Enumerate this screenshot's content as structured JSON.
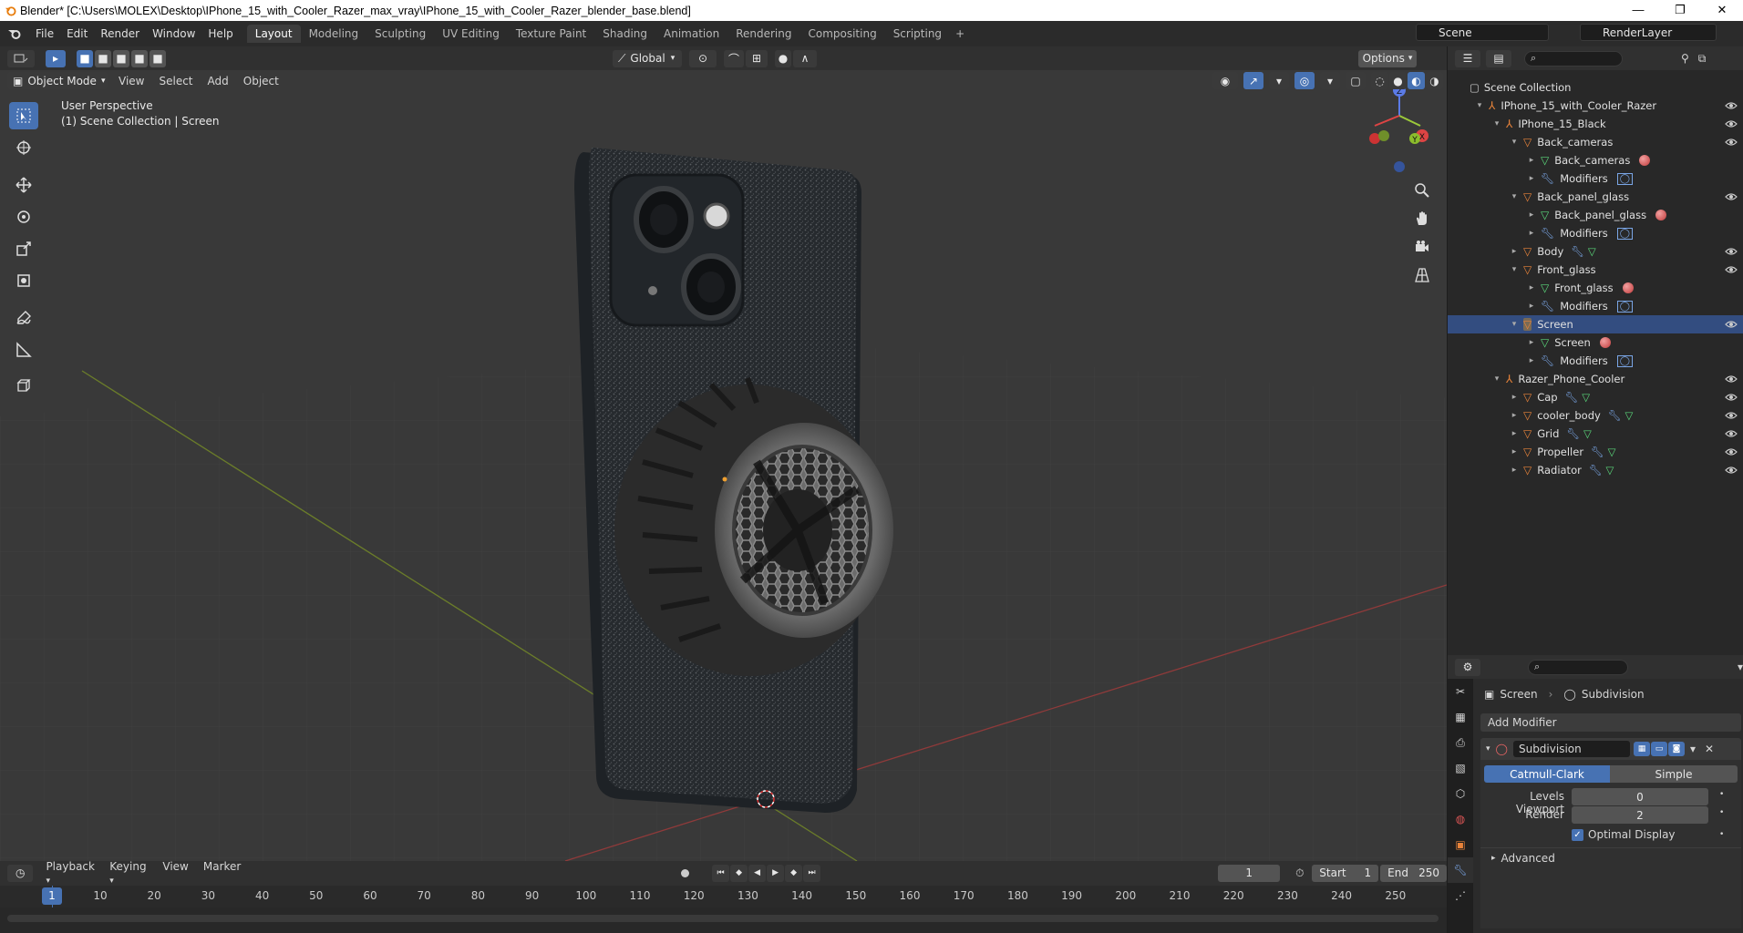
{
  "window": {
    "title": "Blender* [C:\\Users\\MOLEX\\Desktop\\IPhone_15_with_Cooler_Razer_max_vray\\IPhone_15_with_Cooler_Razer_blender_base.blend]",
    "minimize": "—",
    "maximize": "❐",
    "close": "✕"
  },
  "menu": [
    "File",
    "Edit",
    "Render",
    "Window",
    "Help"
  ],
  "workspaces": [
    "Layout",
    "Modeling",
    "Sculpting",
    "UV Editing",
    "Texture Paint",
    "Shading",
    "Animation",
    "Rendering",
    "Compositing",
    "Scripting"
  ],
  "workspace_active": "Layout",
  "workspace_add": "+",
  "scene": {
    "label": "Scene",
    "layer": "RenderLayer"
  },
  "header3d": {
    "transform_orient": "Global",
    "options": "Options"
  },
  "header3d_menu": {
    "mode": "Object Mode",
    "items": [
      "View",
      "Select",
      "Add",
      "Object"
    ]
  },
  "viewport_info": {
    "line1": "User Perspective",
    "line2": "(1) Scene Collection | Screen"
  },
  "gizmo": {
    "x": "X",
    "y": "Y",
    "z": "Z"
  },
  "outliner": {
    "root": "Scene Collection",
    "rows": [
      {
        "label": "IPhone_15_with_Cooler_Razer",
        "indent": 1,
        "type": "empty",
        "arrow": "▾",
        "eye": true
      },
      {
        "label": "IPhone_15_Black",
        "indent": 2,
        "type": "empty",
        "arrow": "▾",
        "eye": true
      },
      {
        "label": "Back_cameras",
        "indent": 3,
        "type": "mesh",
        "arrow": "▾",
        "eye": true
      },
      {
        "label": "Back_cameras",
        "indent": 4,
        "type": "data",
        "arrow": "▸",
        "mat": true
      },
      {
        "label": "Modifiers",
        "indent": 4,
        "type": "mod",
        "arrow": "▸",
        "sub": true
      },
      {
        "label": "Back_panel_glass",
        "indent": 3,
        "type": "mesh",
        "arrow": "▾",
        "eye": true
      },
      {
        "label": "Back_panel_glass",
        "indent": 4,
        "type": "data",
        "arrow": "▸",
        "mat": true
      },
      {
        "label": "Modifiers",
        "indent": 4,
        "type": "mod",
        "arrow": "▸",
        "sub": true
      },
      {
        "label": "Body",
        "indent": 3,
        "type": "mesh",
        "arrow": "▸",
        "eye": true,
        "extra": true
      },
      {
        "label": "Front_glass",
        "indent": 3,
        "type": "mesh",
        "arrow": "▾",
        "eye": true
      },
      {
        "label": "Front_glass",
        "indent": 4,
        "type": "data",
        "arrow": "▸",
        "mat": true
      },
      {
        "label": "Modifiers",
        "indent": 4,
        "type": "mod",
        "arrow": "▸",
        "sub": true
      },
      {
        "label": "Screen",
        "indent": 3,
        "type": "mesh",
        "arrow": "▾",
        "eye": true,
        "active": true
      },
      {
        "label": "Screen",
        "indent": 4,
        "type": "data",
        "arrow": "▸",
        "mat": true
      },
      {
        "label": "Modifiers",
        "indent": 4,
        "type": "mod",
        "arrow": "▸",
        "sub": true
      },
      {
        "label": "Razer_Phone_Cooler",
        "indent": 2,
        "type": "empty",
        "arrow": "▾",
        "eye": true
      },
      {
        "label": "Cap",
        "indent": 3,
        "type": "mesh",
        "arrow": "▸",
        "eye": true,
        "extra": true
      },
      {
        "label": "cooler_body",
        "indent": 3,
        "type": "mesh",
        "arrow": "▸",
        "eye": true,
        "extra": true
      },
      {
        "label": "Grid",
        "indent": 3,
        "type": "mesh",
        "arrow": "▸",
        "eye": true,
        "extra": true
      },
      {
        "label": "Propeller",
        "indent": 3,
        "type": "mesh",
        "arrow": "▸",
        "eye": true,
        "extra": true
      },
      {
        "label": "Radiator",
        "indent": 3,
        "type": "mesh",
        "arrow": "▸",
        "eye": true,
        "extra": true
      }
    ]
  },
  "properties": {
    "breadcrumb_object": "Screen",
    "breadcrumb_modifier": "Subdivision",
    "add_modifier": "Add Modifier",
    "modifier_name": "Subdivision",
    "catmull": "Catmull-Clark",
    "simple": "Simple",
    "levels_label": "Levels Viewport",
    "levels_value": "0",
    "render_label": "Render",
    "render_value": "2",
    "optimal_label": "Optimal Display",
    "advanced": "Advanced"
  },
  "timeline": {
    "menus": [
      "Playback",
      "Keying",
      "View",
      "Marker"
    ],
    "current_frame": "1",
    "start_label": "Start",
    "start": "1",
    "end_label": "End",
    "end": "250",
    "playhead": "1",
    "ticks": [
      "10",
      "20",
      "30",
      "40",
      "50",
      "60",
      "70",
      "80",
      "90",
      "100",
      "110",
      "120",
      "130",
      "140",
      "150",
      "160",
      "170",
      "180",
      "190",
      "200",
      "210",
      "220",
      "230",
      "240",
      "250"
    ]
  },
  "colors": {
    "accent": "#4772b3",
    "object_orange": "#e8833a",
    "mesh_green": "#5ad67a",
    "modifier_blue": "#7aa6e6"
  }
}
